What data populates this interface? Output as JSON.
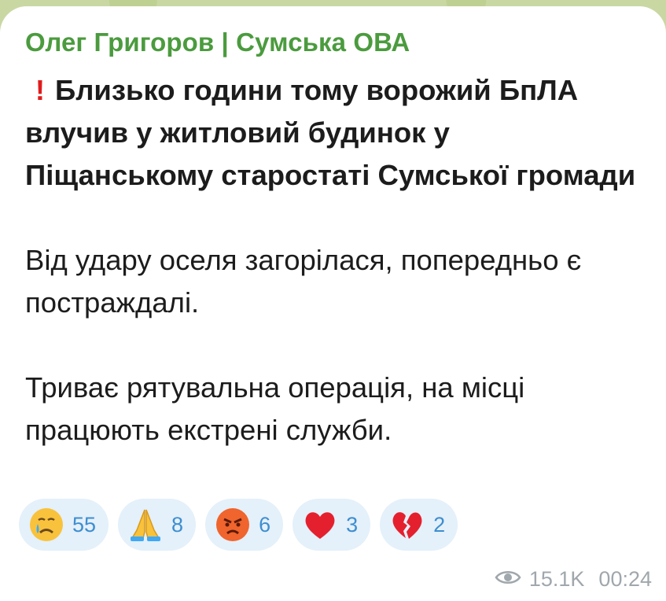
{
  "message": {
    "sender": "Олег Григоров | Сумська ОВА",
    "headline_icon": "exclamation-icon",
    "headline": "Близько години тому ворожий БпЛА влучив у житловий будинок у Піщанському старостаті Сумської громади",
    "paragraph_1": "Від удару оселя загорілася, попередньо є постраждалі.",
    "paragraph_2": "Триває рятувальна операція, на місці працюють екстрені служби.",
    "views": "15.1K",
    "time": "00:24"
  },
  "reactions": [
    {
      "emoji": "crying-face-icon",
      "count": "55"
    },
    {
      "emoji": "folded-hands-icon",
      "count": "8"
    },
    {
      "emoji": "angry-face-icon",
      "count": "6"
    },
    {
      "emoji": "red-heart-icon",
      "count": "3"
    },
    {
      "emoji": "broken-heart-icon",
      "count": "2"
    }
  ],
  "colors": {
    "sender": "#4b9b3e",
    "reaction_bg": "#e4f0fa",
    "reaction_count": "#3d8ed0",
    "alert": "#e11b1b",
    "meta": "#a0a7ad"
  }
}
